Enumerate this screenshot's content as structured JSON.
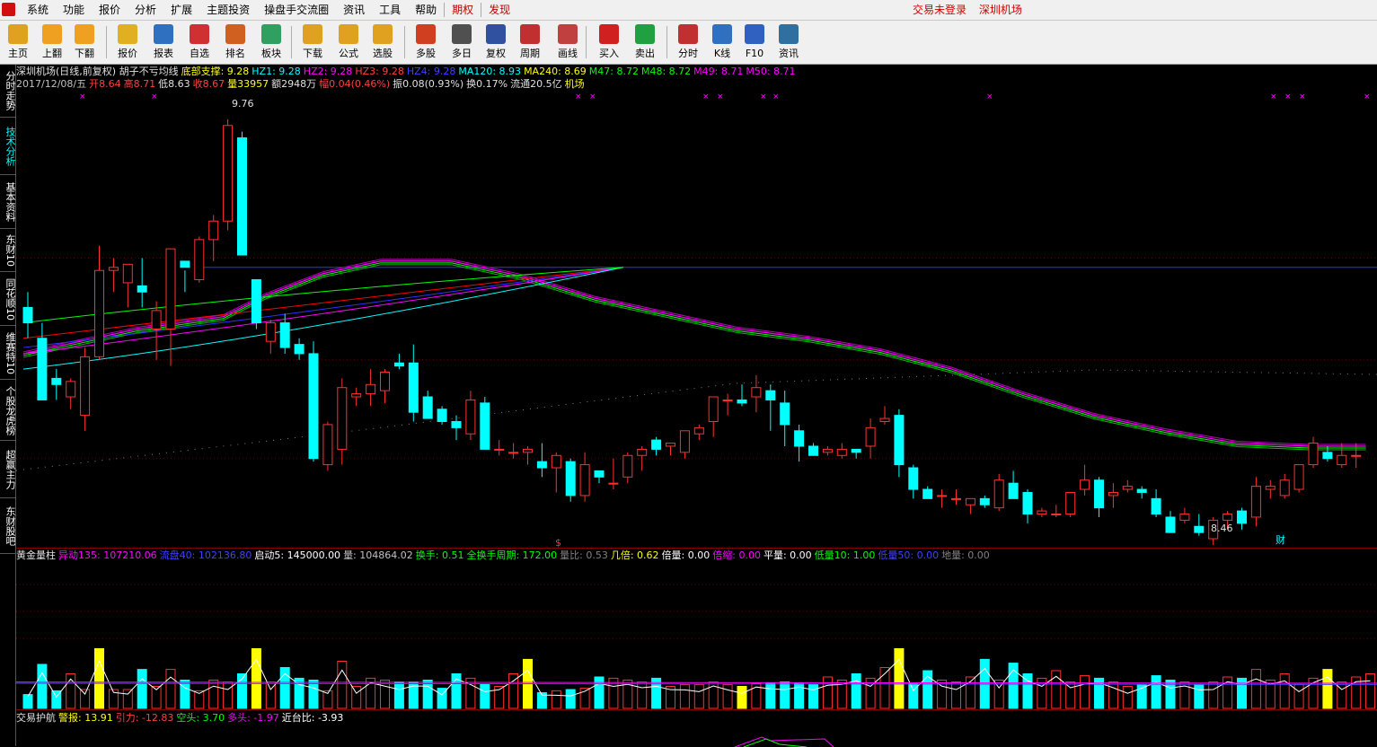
{
  "menubar": {
    "items": [
      "系统",
      "功能",
      "报价",
      "分析",
      "扩展",
      "主题投资",
      "操盘手交流圈",
      "资讯",
      "工具",
      "帮助"
    ],
    "extra": [
      "期权",
      "发现"
    ],
    "status_login": "交易未登录",
    "status_stock": "深圳机场"
  },
  "toolbar": {
    "buttons": [
      "主页",
      "上翻",
      "下翻",
      "报价",
      "报表",
      "自选",
      "排名",
      "板块",
      "下载",
      "公式",
      "选股",
      "多股",
      "多日",
      "复权",
      "周期",
      "画线",
      "买入",
      "卖出",
      "分时",
      "K线",
      "F10",
      "资讯"
    ]
  },
  "sidebar": {
    "tabs": [
      "分时走势",
      "技术分析",
      "基本资料",
      "东财10",
      "同花顺10",
      "维赛特10",
      "个股龙虎榜",
      "超赢主力",
      "东财股吧"
    ]
  },
  "price_header": {
    "line1": [
      {
        "t": "深圳机场(日线,前复权) 胡子不亏均线",
        "c": "#e0e0e0"
      },
      {
        "t": "底部支撑: 9.28",
        "c": "#ffff00"
      },
      {
        "t": "HZ1: 9.28",
        "c": "#00ffff"
      },
      {
        "t": "HZ2: 9.28",
        "c": "#ff00ff"
      },
      {
        "t": "HZ3: 9.28",
        "c": "#ff4040"
      },
      {
        "t": "HZ4: 9.28",
        "c": "#4040ff"
      },
      {
        "t": "MA120: 8.93",
        "c": "#00ffff"
      },
      {
        "t": "MA240: 8.69",
        "c": "#ffff00"
      },
      {
        "t": "M47: 8.72",
        "c": "#00ff00"
      },
      {
        "t": "M48: 8.72",
        "c": "#00ff00"
      },
      {
        "t": "M49: 8.71",
        "c": "#ff00ff"
      },
      {
        "t": "M50: 8.71",
        "c": "#ff00ff"
      }
    ],
    "line2": [
      {
        "t": "2017/12/08/五",
        "c": "#c0c0c0"
      },
      {
        "t": "开8.64",
        "c": "#ff4040"
      },
      {
        "t": "高8.71",
        "c": "#ff4040"
      },
      {
        "t": "低8.63",
        "c": "#e0e0e0"
      },
      {
        "t": "收8.67",
        "c": "#ff4040"
      },
      {
        "t": "量33957",
        "c": "#ffff00"
      },
      {
        "t": "额2948万",
        "c": "#e0e0e0"
      },
      {
        "t": "幅0.04(0.46%)",
        "c": "#ff4040"
      },
      {
        "t": "振0.08(0.93%)",
        "c": "#e0e0e0"
      },
      {
        "t": "换0.17%",
        "c": "#e0e0e0"
      },
      {
        "t": "流通20.5亿",
        "c": "#e0e0e0"
      },
      {
        "t": "机场",
        "c": "#ffff00"
      }
    ]
  },
  "price_labels": {
    "high": "9.76",
    "low": "8.46",
    "cai": "财",
    "dollar": "$"
  },
  "vol_header": [
    {
      "t": "黄金量柱",
      "c": "#e0e0e0"
    },
    {
      "t": "异动135: 107210.06",
      "c": "#ff00ff"
    },
    {
      "t": "流盘40: 102136.80",
      "c": "#4040ff"
    },
    {
      "t": "启动5: 145000.00",
      "c": "#ffffff"
    },
    {
      "t": "量: 104864.02",
      "c": "#c0c0c0"
    },
    {
      "t": "换手: 0.51",
      "c": "#00ff00"
    },
    {
      "t": "全换手周期: 172.00",
      "c": "#00ff00"
    },
    {
      "t": "量比: 0.53",
      "c": "#808080"
    },
    {
      "t": "几倍: 0.62",
      "c": "#ffff00"
    },
    {
      "t": "倍量: 0.00",
      "c": "#ffffff"
    },
    {
      "t": "倍缩: 0.00",
      "c": "#ff00ff"
    },
    {
      "t": "平量: 0.00",
      "c": "#ffffff"
    },
    {
      "t": "低量10: 1.00",
      "c": "#00ff00"
    },
    {
      "t": "低量50: 0.00",
      "c": "#4040ff"
    },
    {
      "t": "地量: 0.00",
      "c": "#808080"
    }
  ],
  "osc_header": [
    {
      "t": "交易护航",
      "c": "#e0e0e0"
    },
    {
      "t": "警报: 13.91",
      "c": "#ffff00"
    },
    {
      "t": "引力: -12.83",
      "c": "#ff4040"
    },
    {
      "t": "空头: 3.70",
      "c": "#00ff00"
    },
    {
      "t": "多头: -1.97",
      "c": "#ff00ff"
    },
    {
      "t": "近台比: -3.93",
      "c": "#ffffff"
    }
  ],
  "chart_data": {
    "type": "candlestick",
    "ylim": [
      8.4,
      9.85
    ],
    "candles": [
      [
        9.15,
        9.2,
        9.05,
        9.1
      ],
      [
        9.05,
        9.1,
        8.85,
        8.85
      ],
      [
        8.92,
        8.95,
        8.85,
        8.9
      ],
      [
        8.86,
        8.92,
        8.82,
        8.91
      ],
      [
        8.8,
        9.02,
        8.75,
        8.99
      ],
      [
        8.99,
        9.35,
        8.98,
        9.27
      ],
      [
        9.27,
        9.31,
        9.2,
        9.28
      ],
      [
        9.23,
        9.28,
        9.15,
        9.29
      ],
      [
        9.22,
        9.31,
        9.15,
        9.2
      ],
      [
        9.08,
        9.17,
        8.98,
        9.14
      ],
      [
        9.08,
        9.3,
        8.96,
        9.34
      ],
      [
        9.3,
        9.27,
        9.2,
        9.28
      ],
      [
        9.24,
        9.38,
        9.23,
        9.37
      ],
      [
        9.37,
        9.45,
        9.3,
        9.43
      ],
      [
        9.43,
        9.76,
        9.4,
        9.74
      ],
      [
        9.7,
        9.72,
        9.32,
        9.32
      ],
      [
        9.24,
        9.18,
        9.08,
        9.1
      ],
      [
        9.04,
        9.11,
        9.0,
        9.1
      ],
      [
        9.1,
        9.13,
        9.0,
        9.02
      ],
      [
        9.03,
        9.05,
        8.98,
        9.0
      ],
      [
        9.0,
        9.04,
        8.65,
        8.66
      ],
      [
        8.64,
        8.78,
        8.62,
        8.77
      ],
      [
        8.69,
        8.92,
        8.64,
        8.89
      ],
      [
        8.86,
        8.89,
        8.83,
        8.87
      ],
      [
        8.87,
        8.95,
        8.83,
        8.9
      ],
      [
        8.88,
        8.95,
        8.84,
        8.94
      ],
      [
        8.97,
        9.0,
        8.95,
        8.96
      ],
      [
        8.97,
        9.03,
        8.78,
        8.81
      ],
      [
        8.86,
        8.88,
        8.8,
        8.79
      ],
      [
        8.82,
        8.83,
        8.77,
        8.78
      ],
      [
        8.78,
        8.8,
        8.72,
        8.76
      ],
      [
        8.74,
        8.88,
        8.72,
        8.85
      ],
      [
        8.84,
        8.86,
        8.72,
        8.69
      ],
      [
        8.69,
        8.72,
        8.67,
        8.69
      ],
      [
        8.68,
        8.71,
        8.66,
        8.68
      ],
      [
        8.68,
        8.7,
        8.64,
        8.69
      ],
      [
        8.65,
        8.71,
        8.6,
        8.63
      ],
      [
        8.63,
        8.68,
        8.55,
        8.67
      ],
      [
        8.65,
        8.66,
        8.52,
        8.54
      ],
      [
        8.54,
        8.68,
        8.52,
        8.64
      ],
      [
        8.62,
        8.62,
        8.58,
        8.6
      ],
      [
        8.58,
        8.66,
        8.56,
        8.58
      ],
      [
        8.6,
        8.68,
        8.58,
        8.67
      ],
      [
        8.67,
        8.7,
        8.62,
        8.69
      ],
      [
        8.72,
        8.73,
        8.67,
        8.69
      ],
      [
        8.7,
        8.71,
        8.67,
        8.71
      ],
      [
        8.68,
        8.74,
        8.66,
        8.75
      ],
      [
        8.74,
        8.77,
        8.72,
        8.76
      ],
      [
        8.78,
        8.86,
        8.73,
        8.86
      ],
      [
        8.85,
        8.87,
        8.8,
        8.85
      ],
      [
        8.85,
        8.9,
        8.83,
        8.84
      ],
      [
        8.86,
        8.93,
        8.81,
        8.89
      ],
      [
        8.88,
        8.9,
        8.75,
        8.85
      ],
      [
        8.84,
        8.88,
        8.7,
        8.77
      ],
      [
        8.75,
        8.77,
        8.65,
        8.7
      ],
      [
        8.7,
        8.71,
        8.67,
        8.67
      ],
      [
        8.68,
        8.7,
        8.67,
        8.69
      ],
      [
        8.67,
        8.71,
        8.66,
        8.69
      ],
      [
        8.69,
        8.69,
        8.66,
        8.68
      ],
      [
        8.7,
        8.79,
        8.66,
        8.76
      ],
      [
        8.78,
        8.83,
        8.77,
        8.79
      ],
      [
        8.8,
        8.82,
        8.6,
        8.64
      ],
      [
        8.63,
        8.64,
        8.53,
        8.56
      ],
      [
        8.56,
        8.57,
        8.53,
        8.53
      ],
      [
        8.54,
        8.56,
        8.5,
        8.54
      ],
      [
        8.53,
        8.56,
        8.51,
        8.53
      ],
      [
        8.51,
        8.53,
        8.48,
        8.53
      ],
      [
        8.53,
        8.54,
        8.5,
        8.51
      ],
      [
        8.5,
        8.61,
        8.49,
        8.59
      ],
      [
        8.58,
        8.62,
        8.53,
        8.53
      ],
      [
        8.55,
        8.56,
        8.45,
        8.48
      ],
      [
        8.48,
        8.5,
        8.47,
        8.49
      ],
      [
        8.48,
        8.51,
        8.47,
        8.48
      ],
      [
        8.48,
        8.55,
        8.47,
        8.55
      ],
      [
        8.56,
        8.64,
        8.54,
        8.59
      ],
      [
        8.59,
        8.6,
        8.47,
        8.5
      ],
      [
        8.54,
        8.58,
        8.5,
        8.55
      ],
      [
        8.56,
        8.59,
        8.55,
        8.57
      ],
      [
        8.56,
        8.57,
        8.53,
        8.55
      ],
      [
        8.53,
        8.56,
        8.47,
        8.48
      ],
      [
        8.47,
        8.49,
        8.42,
        8.42
      ],
      [
        8.46,
        8.5,
        8.45,
        8.48
      ],
      [
        8.44,
        8.48,
        8.41,
        8.42
      ],
      [
        8.4,
        8.47,
        8.38,
        8.46
      ],
      [
        8.46,
        8.49,
        8.43,
        8.48
      ],
      [
        8.49,
        8.5,
        8.43,
        8.45
      ],
      [
        8.47,
        8.6,
        8.44,
        8.57
      ],
      [
        8.56,
        8.59,
        8.53,
        8.57
      ],
      [
        8.54,
        8.61,
        8.53,
        8.59
      ],
      [
        8.56,
        8.62,
        8.55,
        8.64
      ],
      [
        8.64,
        8.73,
        8.63,
        8.71
      ],
      [
        8.68,
        8.7,
        8.65,
        8.66
      ],
      [
        8.64,
        8.71,
        8.63,
        8.67
      ],
      [
        8.67,
        8.71,
        8.63,
        8.67
      ]
    ],
    "ma_long": [
      [
        0,
        9.0
      ],
      [
        4,
        9.04
      ],
      [
        8,
        9.08
      ],
      [
        14,
        9.12
      ],
      [
        17,
        9.19
      ],
      [
        21,
        9.26
      ],
      [
        25,
        9.3
      ],
      [
        30,
        9.3
      ],
      [
        35,
        9.25
      ],
      [
        40,
        9.18
      ],
      [
        45,
        9.13
      ],
      [
        50,
        9.08
      ],
      [
        55,
        9.05
      ],
      [
        60,
        9.01
      ],
      [
        65,
        8.95
      ],
      [
        70,
        8.87
      ],
      [
        75,
        8.8
      ],
      [
        80,
        8.75
      ],
      [
        85,
        8.71
      ],
      [
        90,
        8.7
      ],
      [
        94,
        8.7
      ]
    ],
    "volume": [
      0.22,
      0.7,
      0.28,
      0.55,
      0.3,
      0.95,
      0.3,
      0.3,
      0.62,
      0.35,
      0.62,
      0.45,
      0.28,
      0.45,
      0.42,
      0.55,
      0.95,
      0.42,
      0.65,
      0.48,
      0.45,
      0.28,
      0.75,
      0.35,
      0.48,
      0.45,
      0.42,
      0.42,
      0.45,
      0.32,
      0.55,
      0.48,
      0.38,
      0.35,
      0.55,
      0.78,
      0.25,
      0.28,
      0.3,
      0.32,
      0.5,
      0.48,
      0.45,
      0.42,
      0.48,
      0.35,
      0.38,
      0.38,
      0.42,
      0.38,
      0.35,
      0.4,
      0.4,
      0.42,
      0.4,
      0.38,
      0.5,
      0.45,
      0.55,
      0.48,
      0.65,
      0.95,
      0.4,
      0.6,
      0.45,
      0.42,
      0.5,
      0.78,
      0.45,
      0.72,
      0.55,
      0.48,
      0.6,
      0.42,
      0.52,
      0.48,
      0.42,
      0.35,
      0.38,
      0.52,
      0.45,
      0.42,
      0.38,
      0.42,
      0.5,
      0.48,
      0.62,
      0.45,
      0.55,
      0.38,
      0.48,
      0.62,
      0.42,
      0.5,
      0.55
    ]
  }
}
